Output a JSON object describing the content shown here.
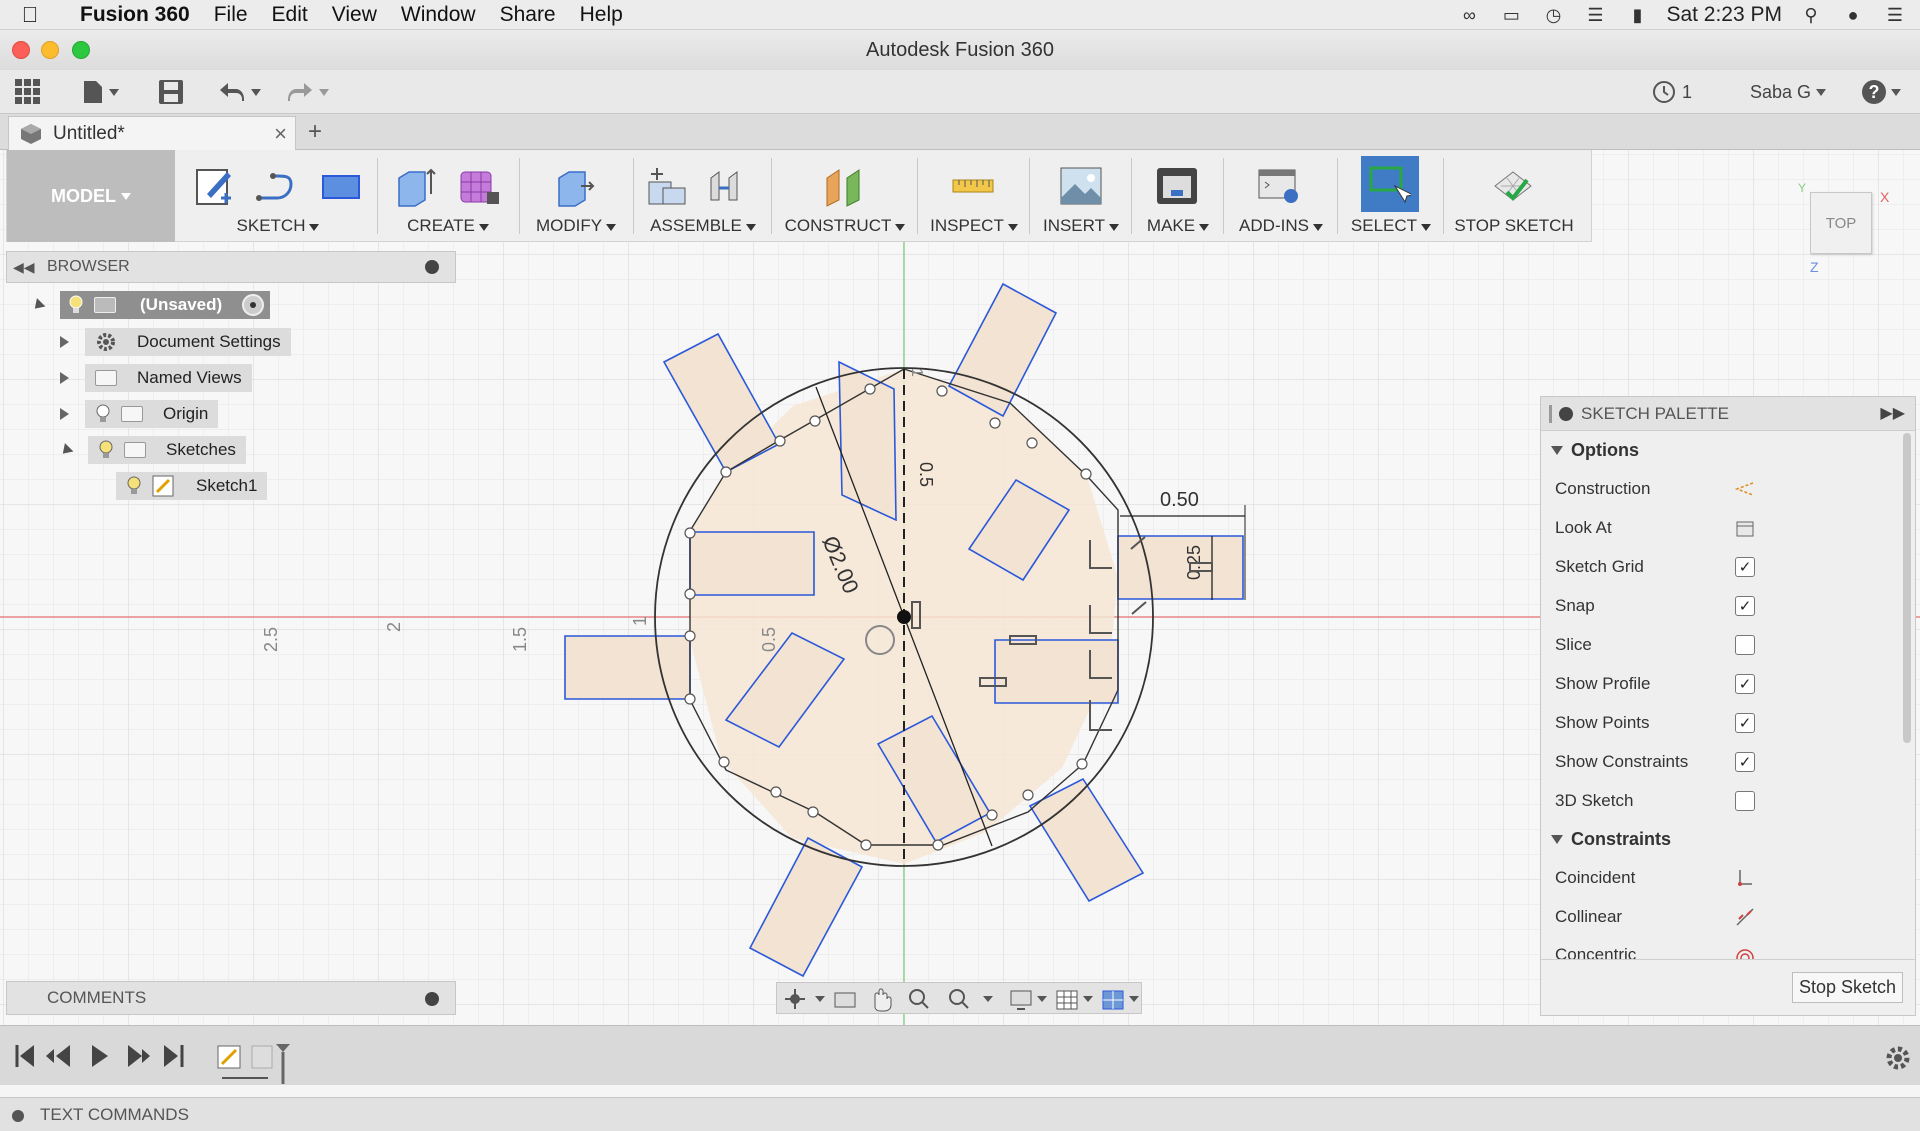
{
  "menubar": {
    "app_name": "Fusion 360",
    "items": [
      "File",
      "Edit",
      "View",
      "Window",
      "Share",
      "Help"
    ],
    "clock": "Sat 2:23 PM"
  },
  "window": {
    "title": "Autodesk Fusion 360"
  },
  "qat": {
    "jobs_count": "1",
    "user": "Saba G",
    "help": "?"
  },
  "tabs": {
    "doc_title": "Untitled*"
  },
  "ribbon": {
    "model": "MODEL",
    "groups": [
      "SKETCH",
      "CREATE",
      "MODIFY",
      "ASSEMBLE",
      "CONSTRUCT",
      "INSPECT",
      "INSERT",
      "MAKE",
      "ADD-INS",
      "SELECT",
      "STOP SKETCH"
    ]
  },
  "browser": {
    "title": "BROWSER",
    "root": "(Unsaved)",
    "items": [
      "Document Settings",
      "Named Views",
      "Origin",
      "Sketches",
      "Sketch1"
    ]
  },
  "viewcube": {
    "face": "TOP"
  },
  "canvas": {
    "axis_labels": [
      "2.5",
      "2",
      "1.5",
      "1",
      "0.5"
    ],
    "dim_diameter": "Ø2.00",
    "dim_width": "0.50",
    "dim_height": "0.25",
    "dim_vertical": "0.5",
    "dim_axis_top": "1"
  },
  "palette": {
    "title": "SKETCH PALETTE",
    "options_header": "Options",
    "options": [
      {
        "label": "Construction",
        "control": "construction-icon"
      },
      {
        "label": "Look At",
        "control": "look-at-icon"
      },
      {
        "label": "Sketch Grid",
        "checked": true
      },
      {
        "label": "Snap",
        "checked": true
      },
      {
        "label": "Slice",
        "checked": false
      },
      {
        "label": "Show Profile",
        "checked": true
      },
      {
        "label": "Show Points",
        "checked": true
      },
      {
        "label": "Show Constraints",
        "checked": true
      },
      {
        "label": "3D Sketch",
        "checked": false
      }
    ],
    "constraints_header": "Constraints",
    "constraints": [
      "Coincident",
      "Collinear",
      "Concentric"
    ],
    "stop_button": "Stop Sketch"
  },
  "comments": {
    "title": "COMMENTS"
  },
  "text_commands": {
    "title": "TEXT COMMANDS"
  }
}
